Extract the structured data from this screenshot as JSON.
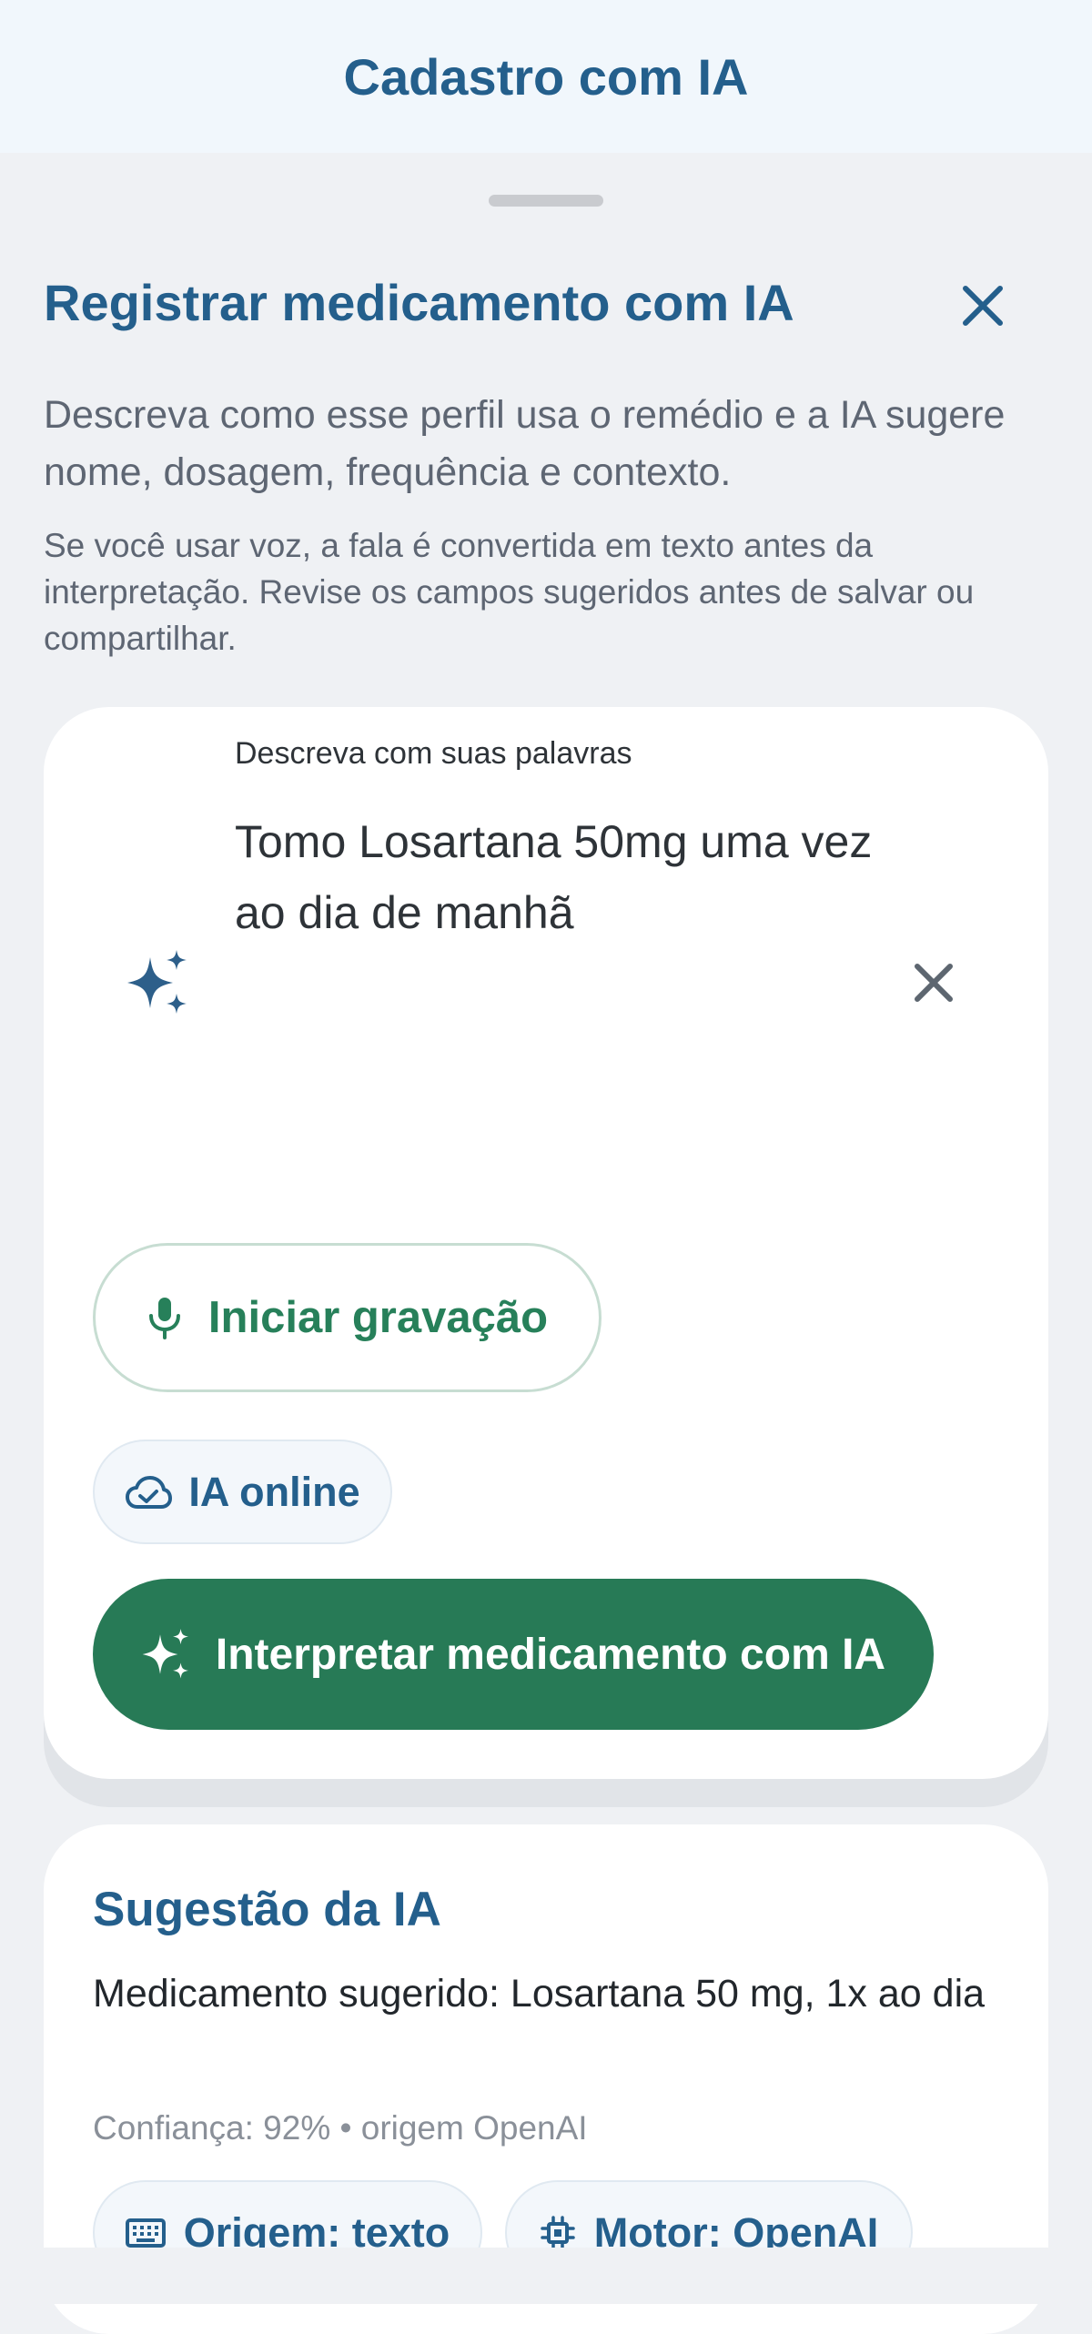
{
  "appbar": {
    "title": "Cadastro com IA"
  },
  "sheet": {
    "title": "Registrar medicamento com IA",
    "description": "Descreva como esse perfil usa o remédio e a IA sugere nome, dosagem, frequência e contexto.",
    "note": "Se você usar voz, a fala é convertida em texto antes da interpretação. Revise os campos sugeridos antes de salvar ou compartilhar."
  },
  "input": {
    "label": "Descreva com suas palavras",
    "value": "Tomo Losartana 50mg uma vez ao dia de manhã"
  },
  "record_button": {
    "label": "Iniciar gravação",
    "icon": "mic-icon"
  },
  "ai_status": {
    "label": "IA online",
    "icon": "cloud-check-icon"
  },
  "interpret_button": {
    "label": "Interpretar medicamento com IA",
    "icon": "sparkle-icon"
  },
  "suggestion": {
    "title": "Sugestão da IA",
    "text": "Medicamento sugerido: Losartana 50 mg, 1x ao dia",
    "confidence": "Confiança: 92% • origem OpenAI",
    "chips": [
      {
        "label": "Origem: texto",
        "icon": "keyboard-icon"
      },
      {
        "label": "Motor: OpenAI",
        "icon": "chip-icon"
      }
    ]
  },
  "colors": {
    "primary": "#245f8c",
    "accent_green": "#277a56",
    "background": "#eff1f4"
  }
}
